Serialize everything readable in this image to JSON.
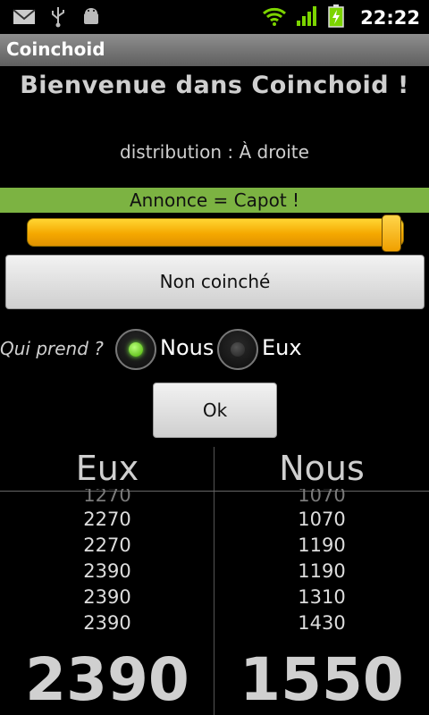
{
  "status_bar": {
    "icons": [
      "gmail-icon",
      "usb-icon",
      "android-debug-icon",
      "wifi-icon",
      "signal-icon",
      "battery-charging-icon"
    ],
    "time": "22:22"
  },
  "app": {
    "title": "Coinchoid"
  },
  "welcome": "Bienvenue dans Coinchoid !",
  "distribution": "distribution : À droite",
  "annonce": "Annonce = Capot !",
  "slider": {
    "value_fraction": 1.0,
    "color": "#f5a800"
  },
  "coinche_button": "Non coinché",
  "qui_prend": {
    "label": "Qui prend ?",
    "options": [
      {
        "label": "Nous",
        "selected": true
      },
      {
        "label": "Eux",
        "selected": false
      }
    ]
  },
  "ok_button": "Ok",
  "scores": {
    "eux": {
      "header": "Eux",
      "history": [
        "1270",
        "2270",
        "2270",
        "2390",
        "2390",
        "2390"
      ],
      "total": "2390"
    },
    "nous": {
      "header": "Nous",
      "history": [
        "1070",
        "1070",
        "1190",
        "1190",
        "1310",
        "1430"
      ],
      "total": "1550"
    }
  },
  "colors": {
    "annonce_bar": "#7cb342",
    "radio_selected": "#48b000"
  }
}
